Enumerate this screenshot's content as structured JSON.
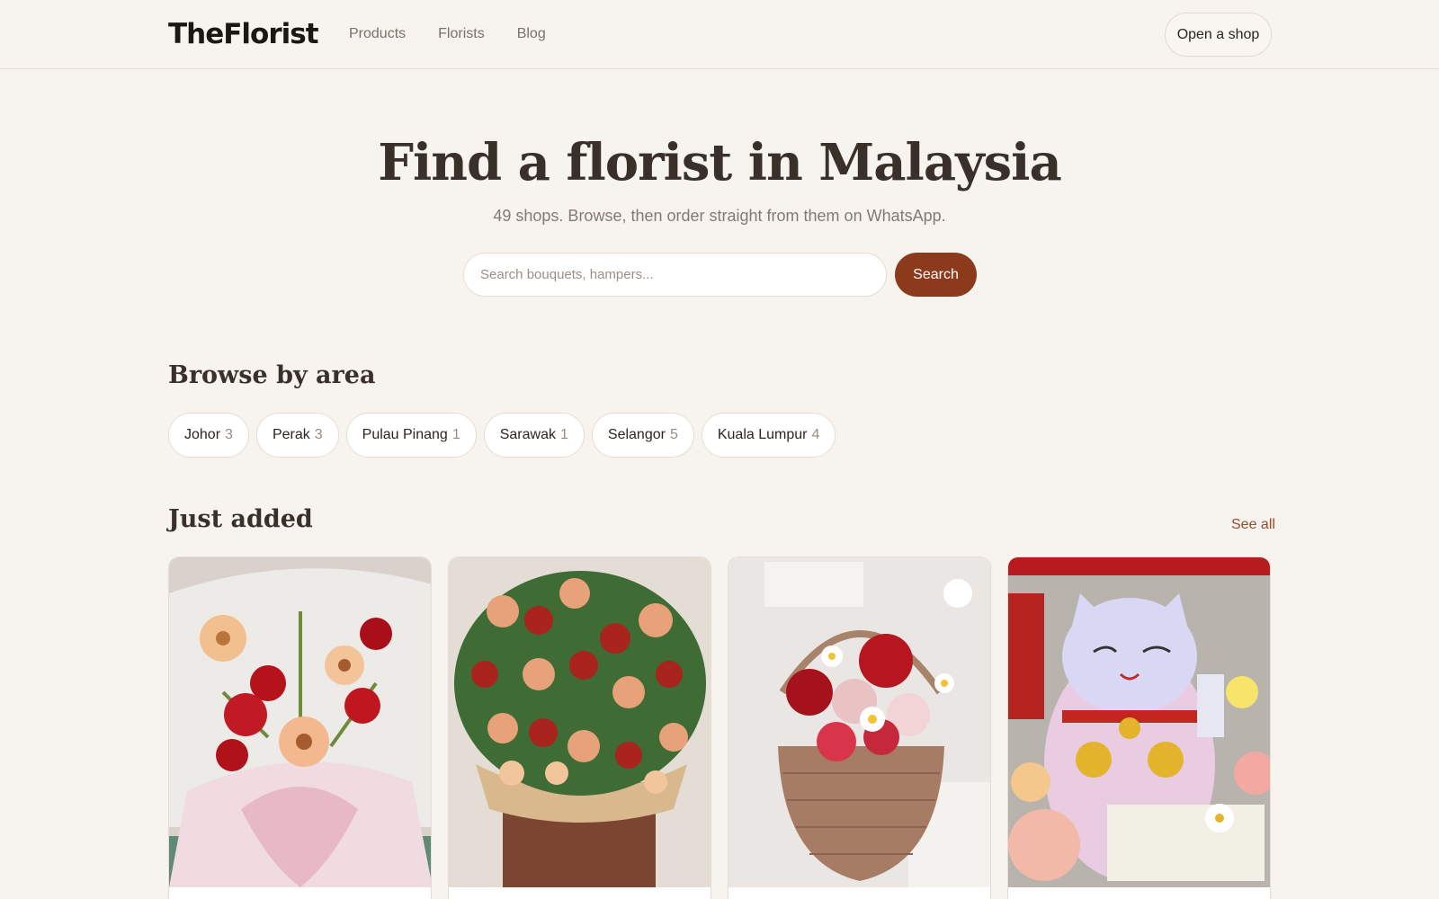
{
  "header": {
    "logo": "TheFlorist",
    "nav": [
      "Products",
      "Florists",
      "Blog"
    ],
    "open_shop_label": "Open a shop"
  },
  "hero": {
    "title": "Find a florist in Malaysia",
    "subtitle": "49 shops. Browse, then order straight from them on WhatsApp.",
    "search_placeholder": "Search bouquets, hampers...",
    "search_value": "",
    "search_button": "Search"
  },
  "areas": {
    "title": "Browse by area",
    "items": [
      {
        "name": "Johor",
        "count": "3"
      },
      {
        "name": "Perak",
        "count": "3"
      },
      {
        "name": "Pulau Pinang",
        "count": "1"
      },
      {
        "name": "Sarawak",
        "count": "1"
      },
      {
        "name": "Selangor",
        "count": "5"
      },
      {
        "name": "Kuala Lumpur",
        "count": "4"
      }
    ]
  },
  "just_added": {
    "title": "Just added",
    "see_all": "See all",
    "products": [
      {
        "image": "bouquet-red-roses-gerberas-photo"
      },
      {
        "image": "rose-arrangement-box-photo"
      },
      {
        "image": "flower-basket-photo"
      },
      {
        "image": "lucky-cat-flower-hamper-photo"
      }
    ]
  },
  "colors": {
    "background": "#f7f3ee",
    "accent": "#8b3a1c",
    "link": "#9a4a26"
  }
}
